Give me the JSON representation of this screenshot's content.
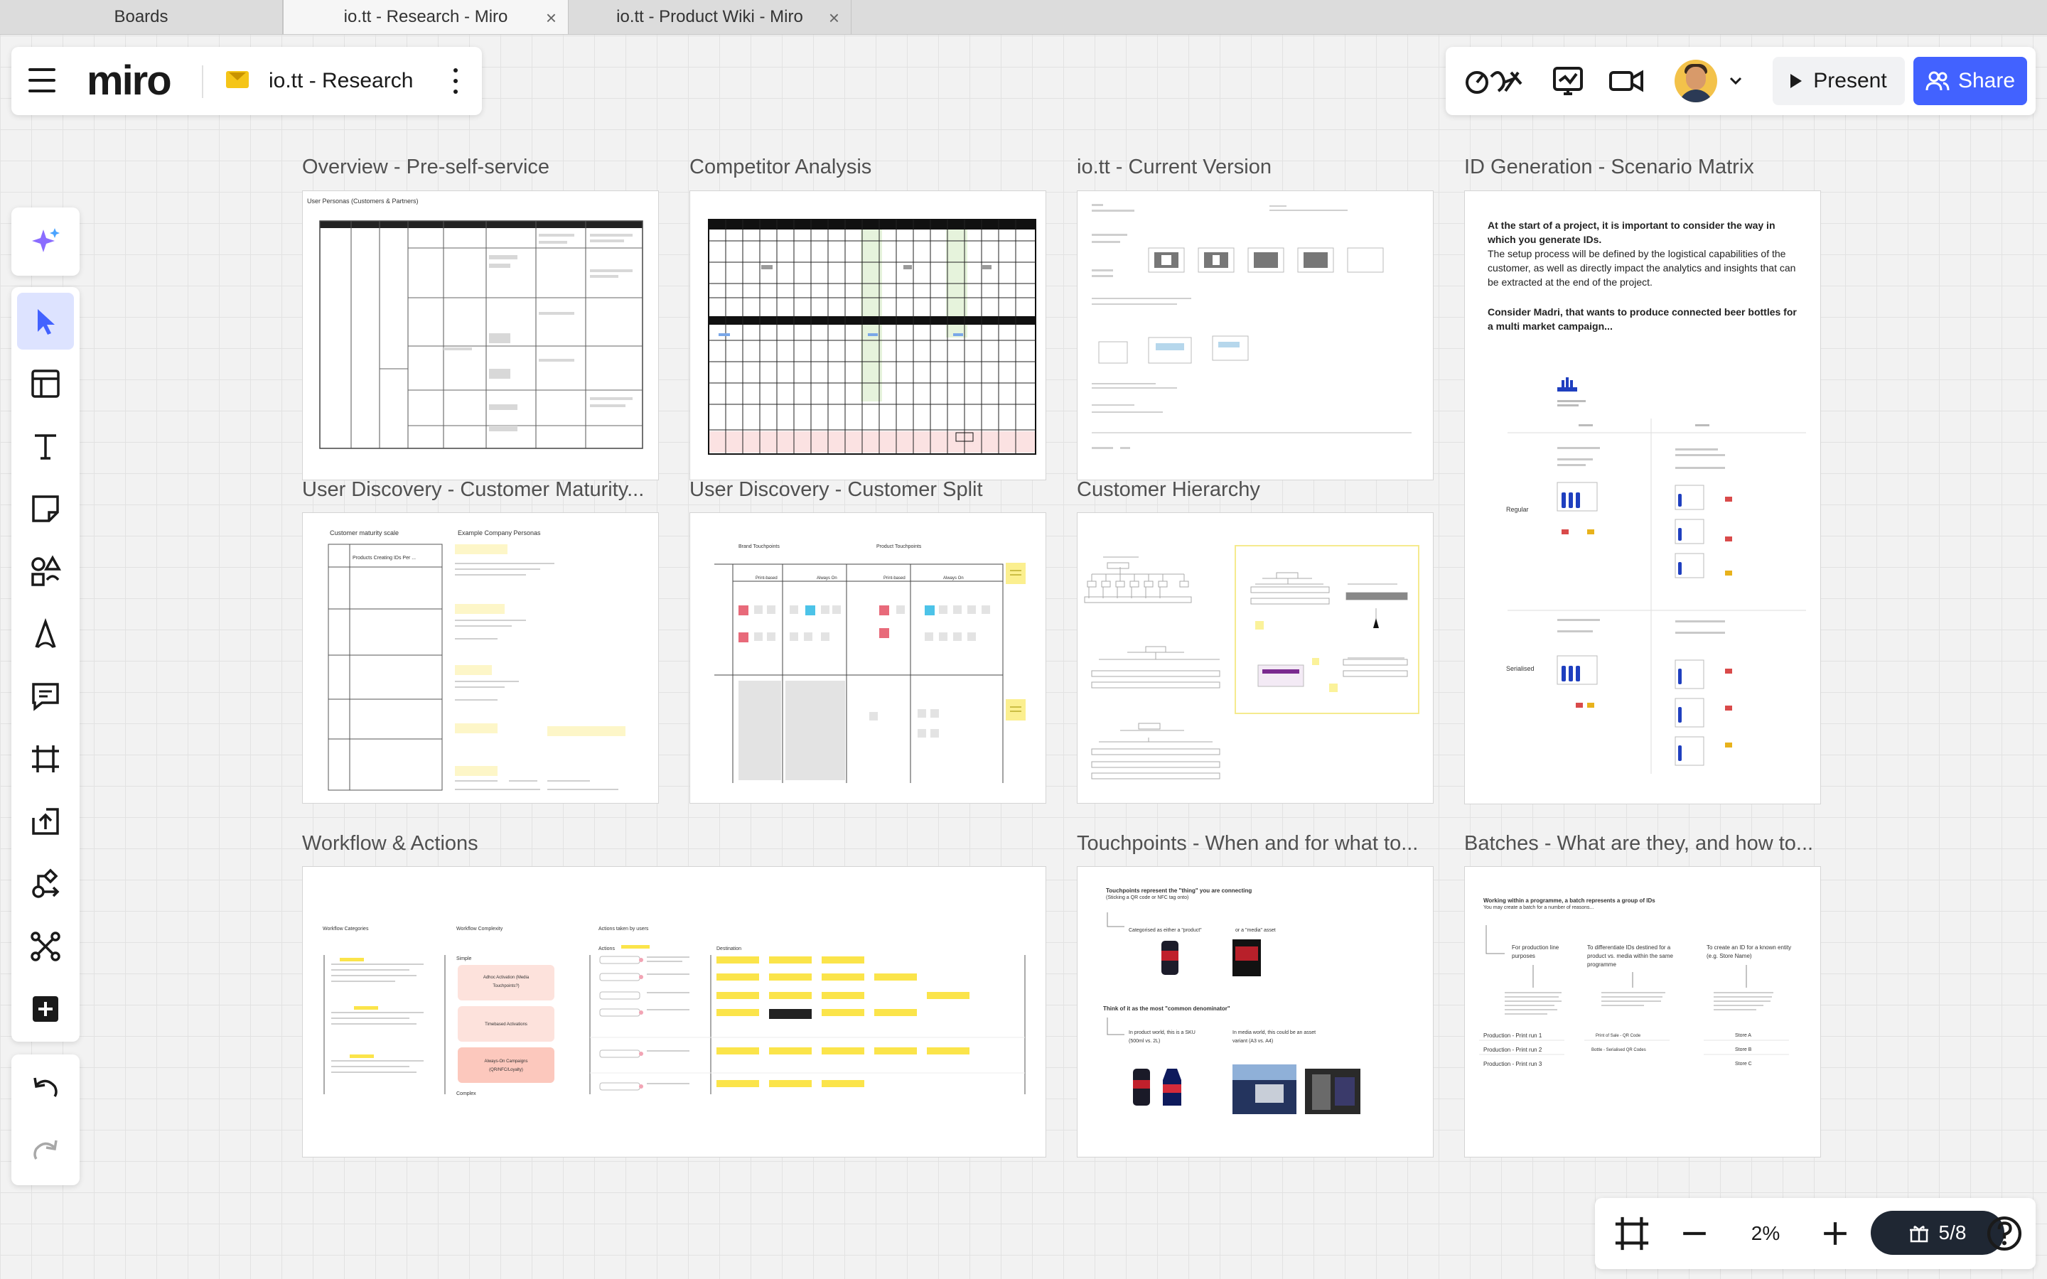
{
  "browser": {
    "tabs": [
      {
        "label": "Boards"
      },
      {
        "label": "io.tt - Research - Miro",
        "close": "×"
      },
      {
        "label": "io.tt - Product Wiki - Miro",
        "close": "×"
      }
    ]
  },
  "header": {
    "logo": "miro",
    "board_title": "io.tt - Research",
    "present_label": "Present",
    "share_label": "Share"
  },
  "zoom": {
    "value": "2%",
    "credits": "5/8"
  },
  "frames": [
    {
      "label": "Overview - Pre-self-service",
      "inner_title": "User Personas (Customers & Partners)"
    },
    {
      "label": "Competitor Analysis"
    },
    {
      "label": "io.tt - Current Version"
    },
    {
      "label": "ID Generation - Scenario Matrix",
      "heading1": "At the start of a project, it is important to consider the way in which you generate IDs.",
      "para1": "The setup process will be defined by the logistical capabilities of the customer, as well as directly impact the analytics and insights that can be extracted at the end of the project.",
      "heading2": "Consider Madri, that wants to produce connected beer bottles for a multi market campaign...",
      "row1": "Regular",
      "row2": "Serialised"
    },
    {
      "label": "User Discovery - Customer Maturity...",
      "col1": "Customer maturity scale",
      "col2": "Example Company Personas",
      "cell": "Products Creating IDs Per ..."
    },
    {
      "label": "User Discovery - Customer Split",
      "col1": "Brand Touchpoints",
      "col2": "Product Touchpoints",
      "c1": "Print-based",
      "c2": "Always On",
      "c3": "Print-based",
      "c4": "Always On"
    },
    {
      "label": "Customer Hierarchy"
    },
    {
      "label": "Workflow & Actions",
      "col1": "Workflow Categories",
      "col2": "Workflow Complexity",
      "col3": "Actions taken by users",
      "simple": "Simple",
      "complex": "Complex",
      "box1": "Adhoc Activation (Media Touchpoints?)",
      "box2": "Timebased Activations",
      "box3": "Always-On Campaigns (QR/NFC/Loyalty)",
      "actions": "Actions",
      "destination": "Destination"
    },
    {
      "label": "Touchpoints - When and for what to...",
      "heading1": "Touchpoints represent the \"thing\" you are connecting",
      "sub1": "(Sticking a QR code or NFC tag onto)",
      "cat_product": "Categorised as either a \"product\"",
      "cat_media": "or a \"media\" asset",
      "heading2": "Think of it as the most \"common denominator\"",
      "product_note": "In product world, this is a SKU (500ml vs. 2L)",
      "media_note": "In media world, this could be an asset variant (A3 vs. A4)"
    },
    {
      "label": "Batches - What are they, and how to...",
      "heading": "Working within a programme, a batch represents a group of IDs",
      "sub": "You may create a batch for a number of reasons...",
      "reason1": "For production line purposes",
      "reason2": "To differentiate IDs destined for a product vs. media within the same programme",
      "reason3": "To create an ID for a known entity (e.g. Store Name)",
      "print1": "Production - Print run 1",
      "print2": "Production - Print run 2",
      "print3": "Production - Print run 3",
      "mid1": "Print of Sale - QR Code",
      "mid2": "Bottle - Serialised QR Codes",
      "storeA": "Store A",
      "storeB": "Store B",
      "storeC": "Store C"
    }
  ]
}
